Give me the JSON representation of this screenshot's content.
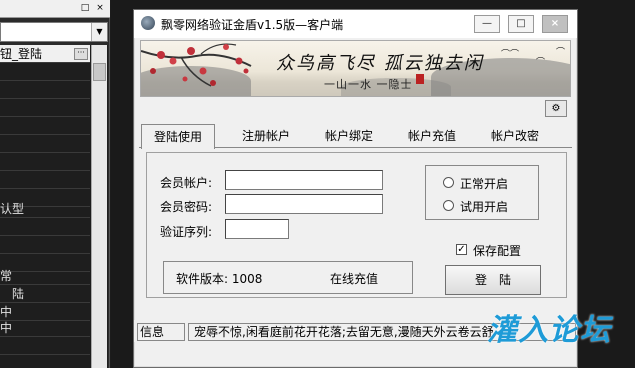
{
  "ide": {
    "top_buttons": [
      "□",
      "×"
    ],
    "rows": [
      "钮_登陆",
      "",
      "",
      "",
      "",
      "",
      "",
      "",
      "",
      "认型",
      "",
      "",
      "",
      "常",
      "陆",
      "中",
      "中",
      ""
    ]
  },
  "window": {
    "title": "飘零网络验证金盾v1.5版—客户端",
    "caption_buttons": {
      "minimize": "—",
      "maximize": "□",
      "close": "×"
    }
  },
  "banner": {
    "poem": "众鸟高飞尽  孤云独去闲",
    "sub": "一山一水 一隐士"
  },
  "tabs": [
    {
      "label": "登陆使用",
      "active": true
    },
    {
      "label": "注册帐户",
      "active": false
    },
    {
      "label": "帐户绑定",
      "active": false
    },
    {
      "label": "帐户充值",
      "active": false
    },
    {
      "label": "帐户改密",
      "active": false
    }
  ],
  "form": {
    "account_label": "会员帐户:",
    "account_value": "",
    "password_label": "会员密码:",
    "password_value": "",
    "serial_label": "验证序列:",
    "serial_value": ""
  },
  "mode": {
    "normal_label": "正常开启",
    "trial_label": "试用开启"
  },
  "save_config_label": "保存配置",
  "save_config_checked": true,
  "login_button": "登陆",
  "version_text": "软件版本: 1008",
  "recharge_online": "在线充值",
  "status": {
    "label": "信息",
    "message": "宠辱不惊,闲看庭前花开花落;去留无意,漫随天外云卷云舒"
  },
  "watermark": "灌入论坛",
  "colors": {
    "watermark": "#1e9bd7"
  }
}
